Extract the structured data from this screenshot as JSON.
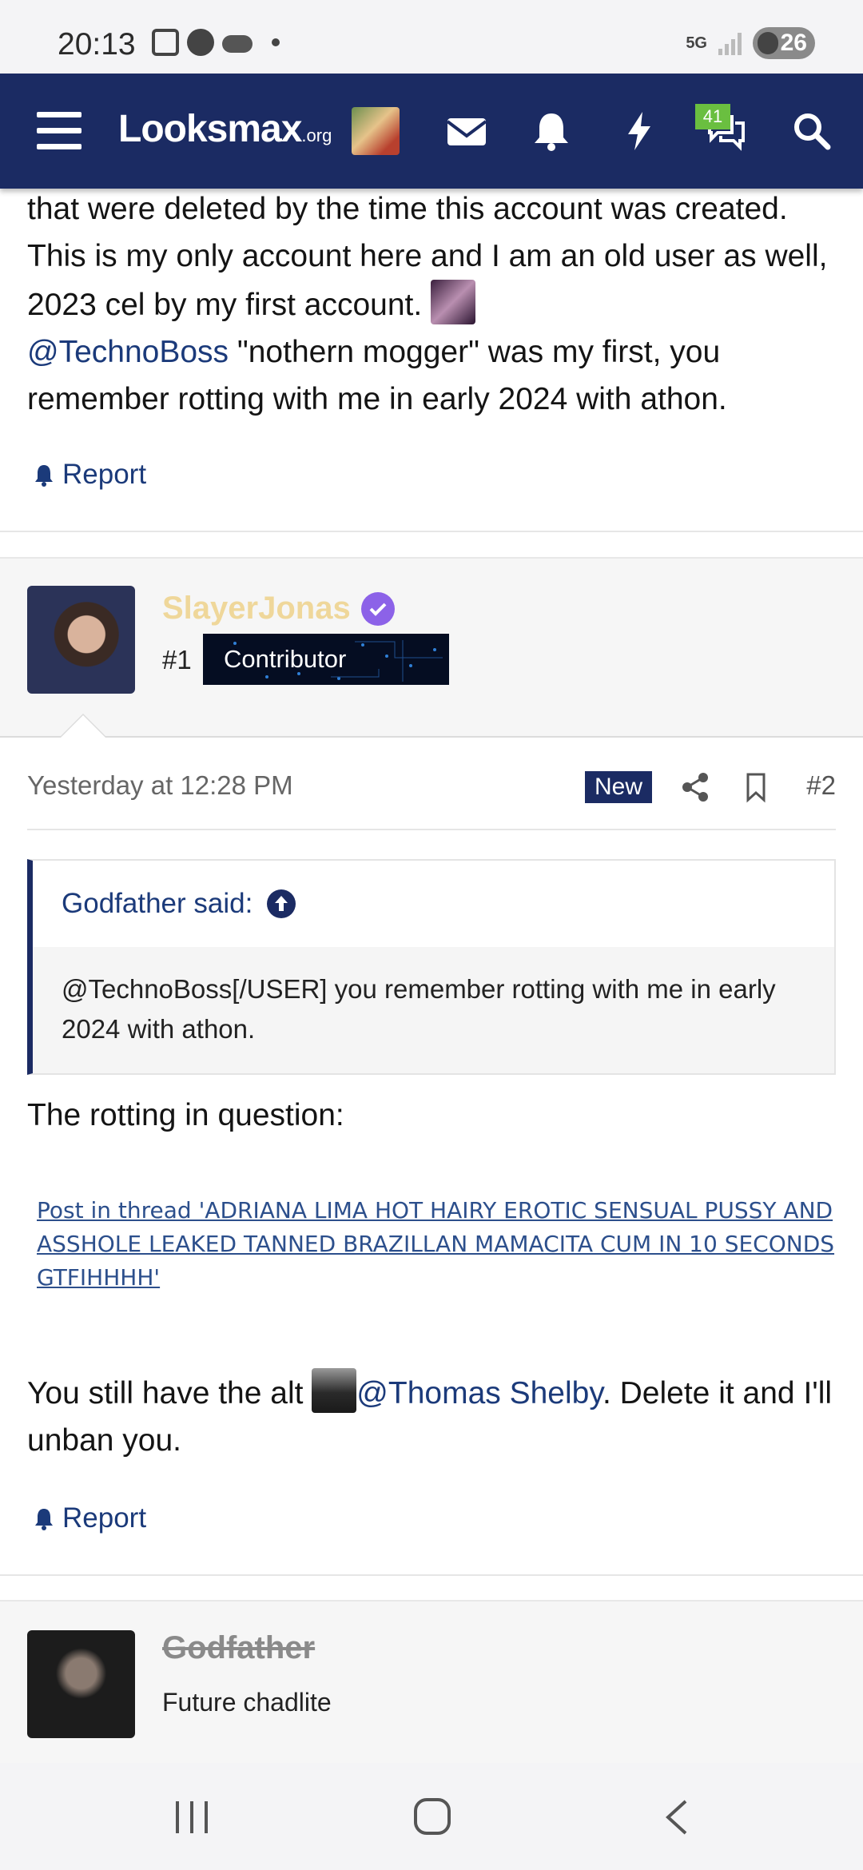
{
  "status_bar": {
    "time": "20:13",
    "network": "5G",
    "battery": "26"
  },
  "navbar": {
    "logo_main": "Looksmax",
    "logo_suffix": ".org",
    "conversations_badge": "41"
  },
  "post1": {
    "text_part1": "that were deleted by the time this account was created. This is my only account here and I am an old user as well, 2023 cel by my first account. ",
    "mention": "@TechnoBoss",
    "text_part2": " \"nothern mogger\" was my first, you remember rotting with me in early 2024 with athon.",
    "report": "Report"
  },
  "post2": {
    "username": "SlayerJonas",
    "rank_number": "#1",
    "rank_title": "Contributor",
    "date": "Yesterday at 12:28 PM",
    "new_label": "New",
    "post_number": "#2",
    "quote_author": "Godfather said:",
    "quote_text": "@TechnoBoss[/USER] you remember rotting with me in early 2024 with athon.",
    "intro": "The rotting in question:",
    "link": "Post in thread 'ADRIANA LIMA HOT HAIRY EROTIC SENSUAL PUSSY AND ASSHOLE LEAKED TANNED BRAZILLAN MAMACITA CUM IN 10 SECONDS GTFIHHHH'",
    "text_before_mention": "You still have the alt ",
    "alt_mention": "@Thomas Shelby",
    "text_after_mention": ". Delete it and I'll unban you.",
    "report": "Report"
  },
  "post3": {
    "username": "Godfather",
    "user_title": "Future chadlite"
  },
  "colors": {
    "navbar": "#1b2b63",
    "link": "#1b3a7a",
    "badge": "#6abf40",
    "verified": "#8c62e8",
    "slayer_name": "#efd79a"
  },
  "icons": [
    "menu-icon",
    "envelope-icon",
    "bell-icon",
    "lightning-icon",
    "conversations-icon",
    "search-icon",
    "share-icon",
    "bookmark-icon",
    "arrow-up-circle-icon"
  ]
}
